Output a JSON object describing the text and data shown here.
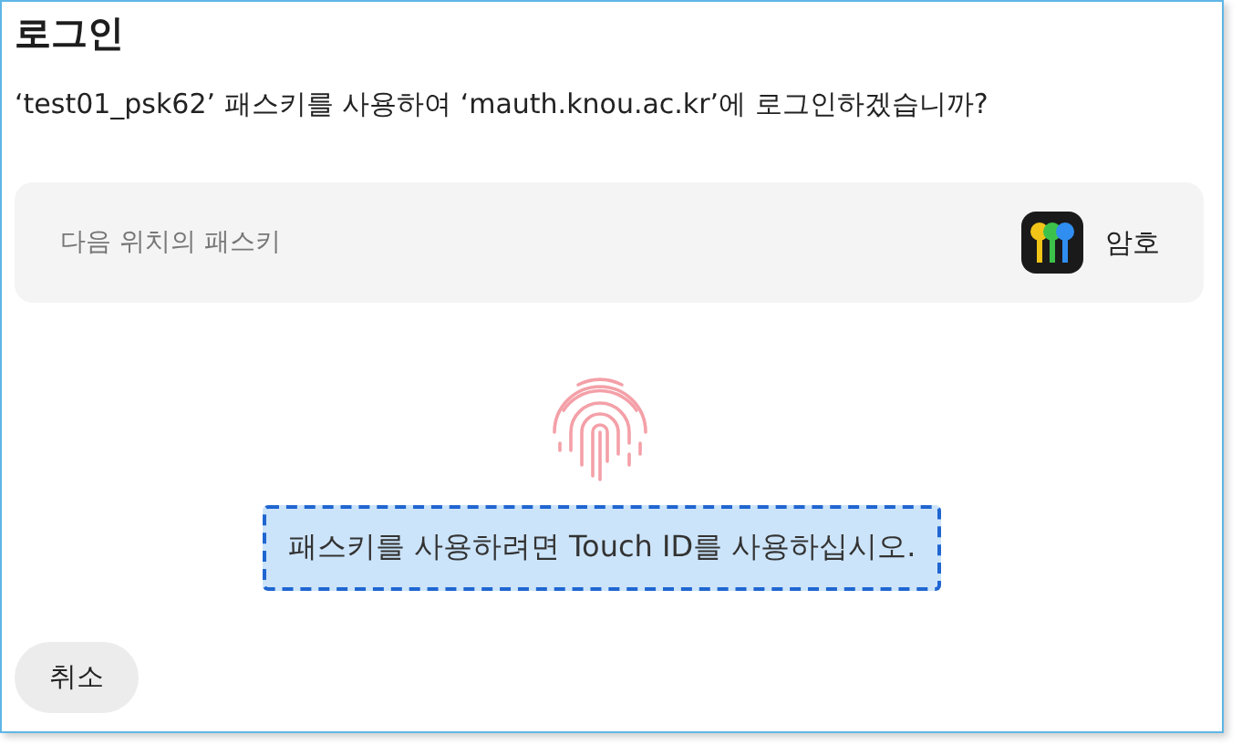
{
  "dialog": {
    "title": "로그인",
    "message": "‘test01_psk62’ 패스키를 사용하여 ‘mauth.knou.ac.kr’에 로그인하겠습니까?",
    "passkey_source": {
      "label": "다음 위치의 패스키",
      "option": "암호"
    },
    "prompt": "패스키를 사용하려면 Touch ID를 사용하십시오.",
    "buttons": [
      "취소"
    ]
  }
}
